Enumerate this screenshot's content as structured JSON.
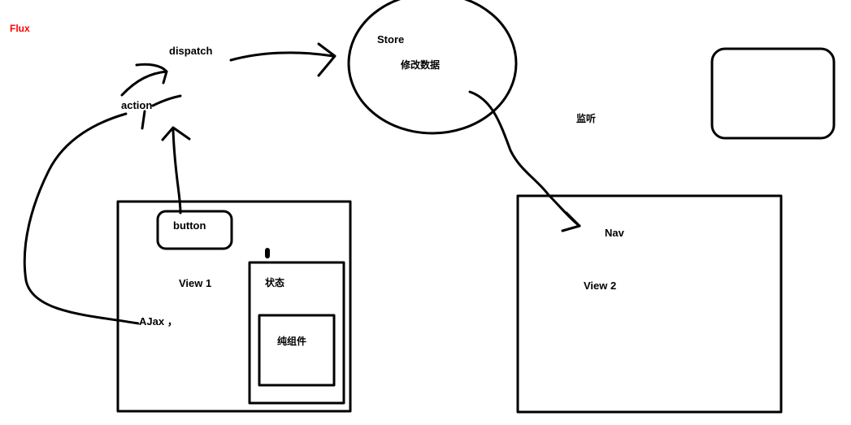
{
  "title": "Flux",
  "colors": {
    "title": "#ff0000",
    "ink": "#000000",
    "background": "#ffffff"
  },
  "labels": {
    "dispatch": "dispatch",
    "action": "action",
    "store": "Store",
    "modify_data": "修改数据",
    "listen": "监听",
    "button": "button",
    "view1": "View 1",
    "state": "状态",
    "pure_component": "纯组件",
    "ajax": "AJax ，",
    "nav": "Nav",
    "view2": "View 2"
  }
}
